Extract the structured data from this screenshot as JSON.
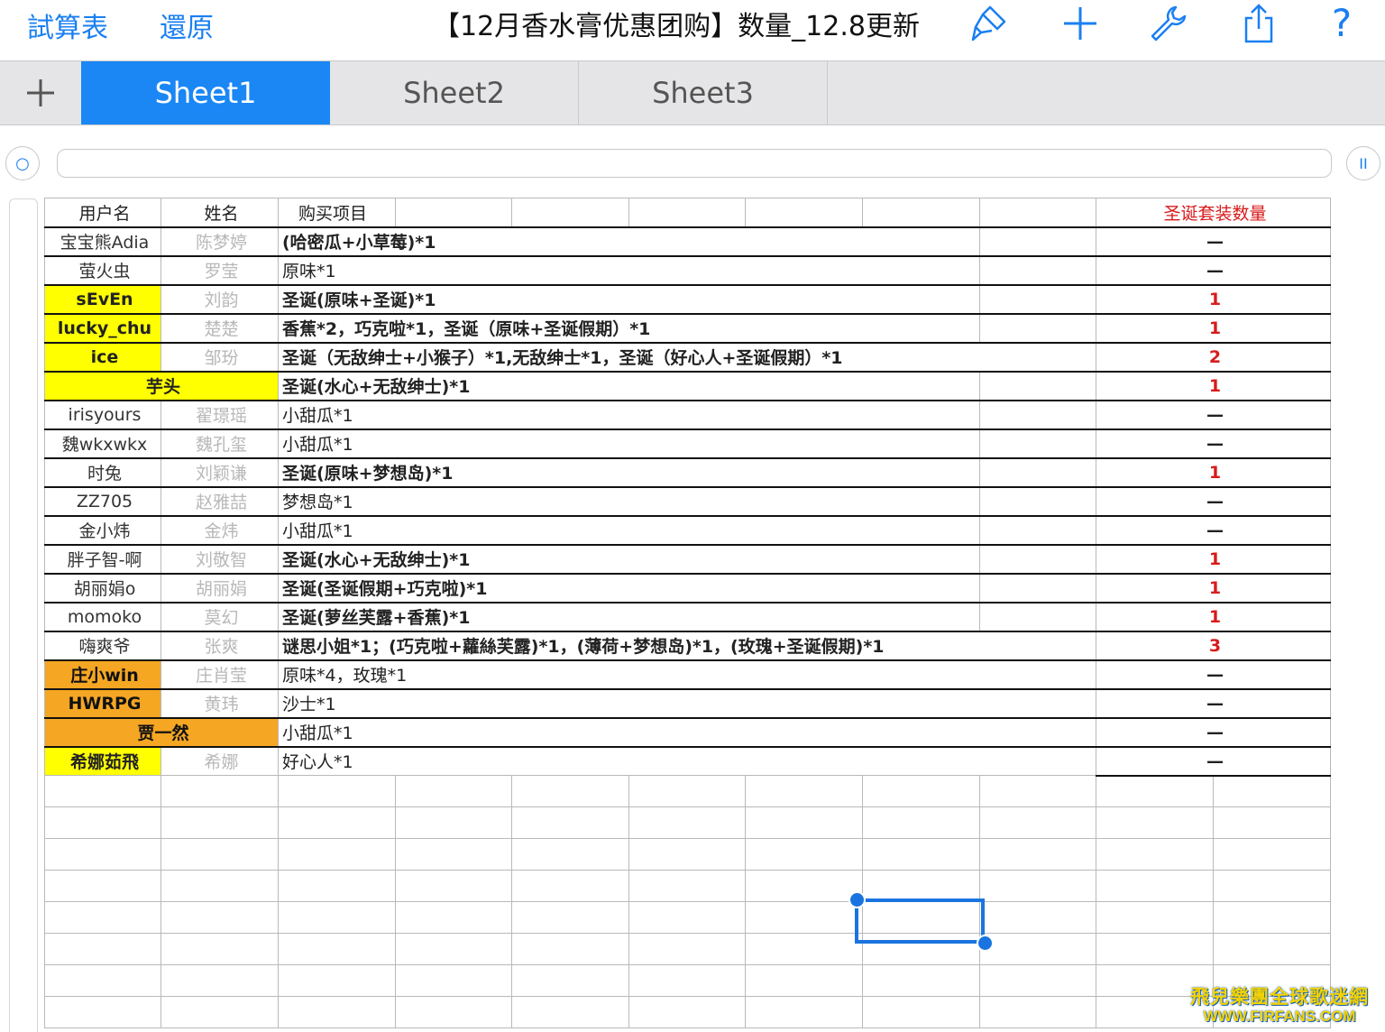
{
  "toolbar": {
    "spreadsheet_label": "試算表",
    "undo_label": "還原",
    "title": "【12月香水膏优惠团购】数量_12.8更新",
    "icons": [
      "paintbrush-icon",
      "plus-icon",
      "wrench-icon",
      "share-icon",
      "help-icon"
    ],
    "help_symbol": "?"
  },
  "tabs": [
    {
      "label": "Sheet1",
      "active": true
    },
    {
      "label": "Sheet2",
      "active": false
    },
    {
      "label": "Sheet3",
      "active": false
    }
  ],
  "formula_bar": {
    "value": "",
    "left_symbol": "○",
    "right_symbol": "II"
  },
  "headers": {
    "user": "用户名",
    "name": "姓名",
    "item": "购买项目",
    "count": "圣诞套装数量"
  },
  "rows": [
    {
      "user": "宝宝熊Adia",
      "name": "陈梦婷",
      "item": "(哈密瓜+小草莓)*1",
      "count": "—"
    },
    {
      "user": "萤火虫",
      "name": "罗莹",
      "item": "原味*1",
      "count": "—"
    },
    {
      "user": "sEvEn",
      "name": "刘韵",
      "item": "圣诞(原味+圣诞)*1",
      "count": "1"
    },
    {
      "user": "lucky_chu",
      "name": "楚楚",
      "item": "香蕉*2，巧克啦*1，圣诞（原味+圣诞假期）*1",
      "count": "1"
    },
    {
      "user": "ice",
      "name": "邹玢",
      "item": "圣诞（无敌绅士+小猴子）*1,无敌绅士*1，圣诞（好心人+圣诞假期）*1",
      "count": "2"
    },
    {
      "user": "芋头",
      "name": "",
      "item": "圣诞(水心+无敌绅士)*1",
      "count": "1"
    },
    {
      "user": "irisyours",
      "name": "翟璟瑶",
      "item": "小甜瓜*1",
      "count": "—"
    },
    {
      "user": "魏wkxwkx",
      "name": "魏孔玺",
      "item": "小甜瓜*1",
      "count": "—"
    },
    {
      "user": "时兔",
      "name": "刘颖谦",
      "item": "圣诞(原味+梦想岛)*1",
      "count": "1"
    },
    {
      "user": "ZZ705",
      "name": "赵雅喆",
      "item": "梦想岛*1",
      "count": "—"
    },
    {
      "user": "金小炜",
      "name": "金炜",
      "item": "小甜瓜*1",
      "count": "—"
    },
    {
      "user": "胖子智-啊",
      "name": "刘敬智",
      "item": "圣诞(水心+无敌绅士)*1",
      "count": "1"
    },
    {
      "user": "胡丽娟o",
      "name": "胡丽娟",
      "item": "圣诞(圣诞假期+巧克啦)*1",
      "count": "1"
    },
    {
      "user": "momoko",
      "name": "莫幻",
      "item": "圣诞(萝丝芙露+香蕉)*1",
      "count": "1"
    },
    {
      "user": "嗨爽爷",
      "name": "张爽",
      "item": "谜思小姐*1；(巧克啦+蘿絲芙露)*1，(薄荷+梦想岛)*1，(玫瑰+圣诞假期)*1",
      "count": "3"
    },
    {
      "user": "庄小win",
      "name": "庄肖莹",
      "item": "原味*4，玫瑰*1",
      "count": "—"
    },
    {
      "user": "HWRPG",
      "name": "黄玮",
      "item": "沙士*1",
      "count": "—"
    },
    {
      "user": "贾一然",
      "name": "",
      "item": "小甜瓜*1",
      "count": "—"
    },
    {
      "user": "希娜茹飛",
      "name": "希娜",
      "item": "好心人*1",
      "count": "—"
    }
  ],
  "watermark": {
    "line1": "飛兒樂團全球歌迷網",
    "line2": "WWW.FIRFANS.COM"
  },
  "colors": {
    "accent": "#1a87f5",
    "highlight_yellow": "#ffff00",
    "highlight_orange": "#f5a623",
    "count_red": "#d81b1b"
  }
}
